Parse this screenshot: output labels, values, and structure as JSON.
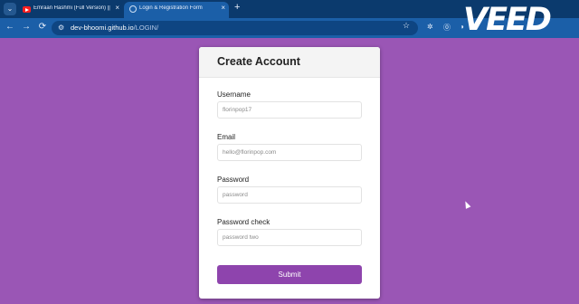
{
  "browser": {
    "tabs": [
      {
        "title": "Emraan Hashmi (Full Version) ||",
        "favicon": "youtube-icon",
        "active": false
      },
      {
        "title": "Login & Registration Form",
        "favicon": "globe-icon",
        "active": true
      }
    ],
    "tab_close_glyph": "×",
    "new_tab_glyph": "+",
    "tab_search_glyph": "⌄",
    "back_glyph": "←",
    "forward_glyph": "→",
    "reload_glyph": "⟳",
    "url": {
      "host": "dev-bhoomi.github.io",
      "path": "/LOGIN/"
    },
    "bookmark_glyph": "☆",
    "extension_glyphs": [
      "✲",
      "⓪",
      "◑"
    ]
  },
  "watermark": {
    "text": "VEED"
  },
  "form": {
    "title": "Create Account",
    "fields": [
      {
        "label": "Username",
        "placeholder": "florinpop17",
        "type": "text"
      },
      {
        "label": "Email",
        "placeholder": "hello@florinpop.com",
        "type": "email"
      },
      {
        "label": "Password",
        "placeholder": "password",
        "type": "password"
      },
      {
        "label": "Password check",
        "placeholder": "password two",
        "type": "password"
      }
    ],
    "submit_label": "Submit"
  },
  "colors": {
    "page_background": "#9a56b5",
    "accent": "#8e44ad",
    "browser_frame": "#1b5fa8"
  }
}
